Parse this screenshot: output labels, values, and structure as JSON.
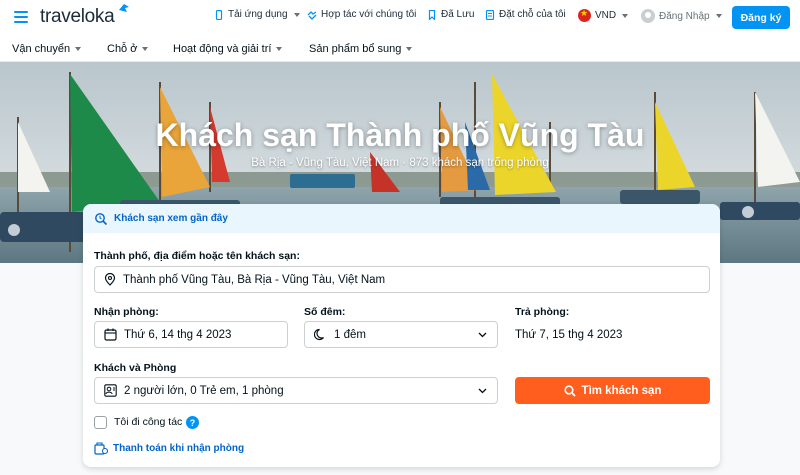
{
  "brand": {
    "name": "traveloka",
    "accent": "#0194f3",
    "cta": "#ff5e1f"
  },
  "topnav": {
    "app": "Tải ứng dụng",
    "partner": "Hợp tác với chúng tôi",
    "saved": "Đã Lưu",
    "bookings": "Đặt chỗ của tôi",
    "currency": "VND",
    "login": "Đăng Nhập",
    "signup": "Đăng ký"
  },
  "secnav": {
    "items": [
      {
        "label": "Vận chuyển"
      },
      {
        "label": "Chỗ ở"
      },
      {
        "label": "Hoạt động và giải trí"
      },
      {
        "label": "Sản phẩm bổ sung"
      }
    ]
  },
  "hero": {
    "title": "Khách sạn Thành phố Vũng Tàu",
    "subtitle": "Bà Rịa - Vũng Tàu, Việt Nam · 873 khách sạn trống phòng"
  },
  "search": {
    "recent_label": "Khách sạn xem gần đây",
    "destination_label": "Thành phố, địa điểm hoặc tên khách sạn:",
    "destination_value": "Thành phố Vũng Tàu, Bà Rịa - Vũng Tàu, Việt Nam",
    "checkin_label": "Nhận phòng:",
    "checkin_value": "Thứ 6, 14 thg 4 2023",
    "nights_label": "Số đêm:",
    "nights_value": "1 đêm",
    "checkout_label": "Trả phòng:",
    "checkout_value": "Thứ 7, 15 thg 4 2023",
    "guests_label": "Khách và Phòng",
    "guests_value": "2 người lớn, 0 Trẻ em, 1 phòng",
    "search_button": "Tìm khách sạn",
    "business_trip": "Tôi đi công tác",
    "help": "?",
    "pay_at_hotel": "Thanh toán khi nhận phòng"
  }
}
